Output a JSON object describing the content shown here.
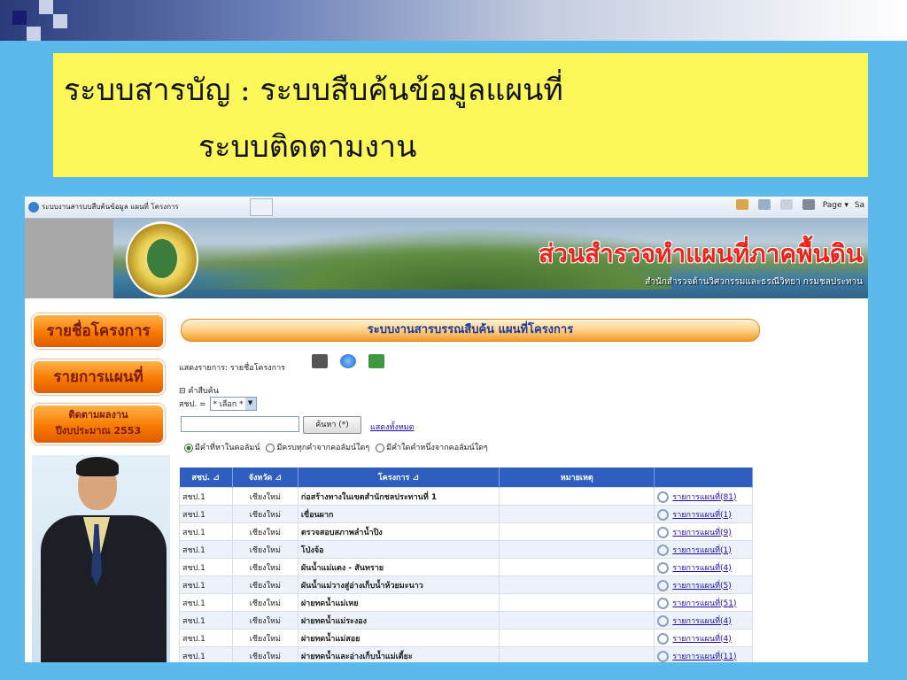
{
  "slide": {
    "title_line1": "ระบบสารบัญ  :  ระบบสืบค้นข้อมูลแผนที่",
    "title_line2": "ระบบติดตามงาน"
  },
  "browser": {
    "tab_title": "ระบบงานสารบบสืบค้นข้อมูล แผนที่ โครงการ",
    "page_menu": "Page ▾",
    "safety_menu": "Sa"
  },
  "banner": {
    "title": "ส่วนสำรวจทำแผนที่ภาคพื้นดิน",
    "subtitle": "สำนักสำรวจด้านวิศวกรรมและธรณีวิทยา  กรมชลประทาน"
  },
  "sidebar": {
    "btn_projects": "รายชื่อโครงการ",
    "btn_maps": "รายการแผนที่",
    "btn_followup_line1": "ติดตามผลงาน",
    "btn_followup_line2": "ปีงบประมาณ 2553"
  },
  "main": {
    "header": "ระบบงานสารบรรณสืบค้น แผนที่โครงการ",
    "show_label": "แสดงรายการ: รายชื่อโครงการ",
    "criteria_label": "⊟ คำสืบค้น",
    "province_label": "สชป. =",
    "province_select": "* เลือก *",
    "search_button": "ค้นหา (*)",
    "show_all_link": "แสดงทั้งหมด",
    "radio_1": "มีคำที่หาในคอลัมน์",
    "radio_2": "มีครบทุกคำจากคอลัมน์ใดๆ",
    "radio_3": "มีคำใดคำหนึ่งจากคอลัมน์ใดๆ"
  },
  "table": {
    "headers": [
      "สชป.",
      "จังหวัด",
      "โครงการ",
      "หมายเหตุ",
      ""
    ],
    "rows": [
      {
        "region": "สชป.1",
        "province": "เชียงใหม่",
        "project": "ก่อสร้างทางในเขตสำนักชลประทานที่ 1",
        "note": "",
        "link": "รายการแผนที่(81)"
      },
      {
        "region": "สชป.1",
        "province": "เชียงใหม่",
        "project": "เขื่อนผาก",
        "note": "",
        "link": "รายการแผนที่(1)"
      },
      {
        "region": "สชป.1",
        "province": "เชียงใหม่",
        "project": "ตรวจสอบสภาพลำน้ำปิง",
        "note": "",
        "link": "รายการแผนที่(9)"
      },
      {
        "region": "สชป.1",
        "province": "เชียงใหม่",
        "project": "โป่งจ้อ",
        "note": "",
        "link": "รายการแผนที่(1)"
      },
      {
        "region": "สชป.1",
        "province": "เชียงใหม่",
        "project": "ผันน้ำแม่แตง - สันทราย",
        "note": "",
        "link": "รายการแผนที่(4)"
      },
      {
        "region": "สชป.1",
        "province": "เชียงใหม่",
        "project": "ผันน้ำแม่วางสู่อ่างเก็บน้ำห้วยมะนาว",
        "note": "",
        "link": "รายการแผนที่(5)"
      },
      {
        "region": "สชป.1",
        "province": "เชียงใหม่",
        "project": "ฝายทดน้ำแม่เหย",
        "note": "",
        "link": "รายการแผนที่(51)"
      },
      {
        "region": "สชป.1",
        "province": "เชียงใหม่",
        "project": "ฝายทดน้ำแม่ระงอง",
        "note": "",
        "link": "รายการแผนที่(4)"
      },
      {
        "region": "สชป.1",
        "province": "เชียงใหม่",
        "project": "ฝายทดน้ำแม่สอย",
        "note": "",
        "link": "รายการแผนที่(4)"
      },
      {
        "region": "สชป.1",
        "province": "เชียงใหม่",
        "project": "ฝายทดน้ำและอ่างเก็บน้ำแม่เตี้ยะ",
        "note": "",
        "link": "รายการแผนที่(11)"
      }
    ]
  }
}
